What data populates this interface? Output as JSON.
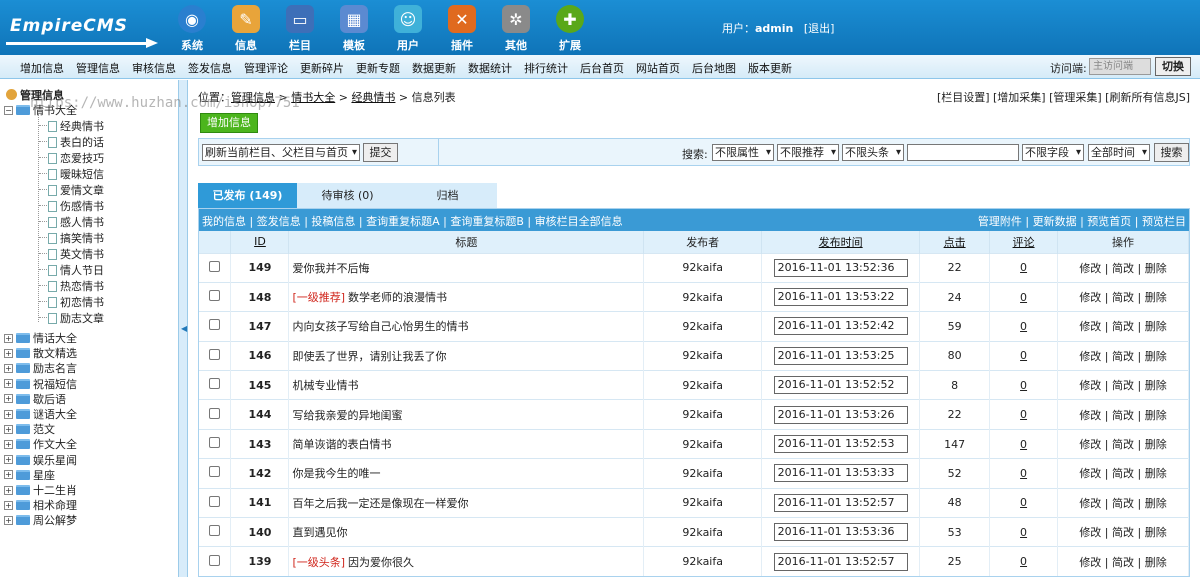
{
  "brand": {
    "logo_text": "EmpireCMS"
  },
  "topnav": [
    {
      "label": "系统",
      "icon": "globe-icon",
      "color": "#2a7fcf"
    },
    {
      "label": "信息",
      "icon": "notepad-icon",
      "color": "#e8a43a"
    },
    {
      "label": "栏目",
      "icon": "folder-icon",
      "color": "#3d6fb8"
    },
    {
      "label": "模板",
      "icon": "window-icon",
      "color": "#5b8ad1"
    },
    {
      "label": "用户",
      "icon": "user-icon",
      "color": "#3fb1d9"
    },
    {
      "label": "插件",
      "icon": "tools-icon",
      "color": "#e06a1f"
    },
    {
      "label": "其他",
      "icon": "gear-icon",
      "color": "#8a8a8a"
    },
    {
      "label": "扩展",
      "icon": "plus-icon",
      "color": "#5aa819"
    }
  ],
  "user": {
    "prefix": "用户：",
    "name": "admin",
    "logout": "[退出]"
  },
  "subnav": [
    "增加信息",
    "管理信息",
    "审核信息",
    "签发信息",
    "管理评论",
    "更新碎片",
    "更新专题",
    "数据更新",
    "数据统计",
    "排行统计",
    "后台首页",
    "网站首页",
    "后台地图",
    "版本更新"
  ],
  "visit": {
    "label": "访问端:",
    "selected": "主访问端",
    "button": "切换"
  },
  "watermark": "https://www.huzhan.com/ishop7751",
  "tree": {
    "root": "管理信息",
    "open_node": "情书大全",
    "children": [
      "经典情书",
      "表白的话",
      "恋爱技巧",
      "暧昧短信",
      "爱情文章",
      "伤感情书",
      "感人情书",
      "搞笑情书",
      "英文情书",
      "情人节日",
      "热恋情书",
      "初恋情书",
      "励志文章"
    ],
    "nodes": [
      "情话大全",
      "散文精选",
      "励志名言",
      "祝福短信",
      "歇后语",
      "谜语大全",
      "范文",
      "作文大全",
      "娱乐星闻",
      "星座",
      "十二生肖",
      "相术命理",
      "周公解梦"
    ]
  },
  "location": {
    "prefix": "位置：",
    "crumbs": [
      "管理信息",
      "情书大全",
      "经典情书"
    ],
    "sep": " > ",
    "last": "信息列表"
  },
  "location_links": "[栏目设置] [增加采集] [管理采集] [刷新所有信息JS]",
  "add_button": "增加信息",
  "refresh": {
    "selected": "刷新当前栏目、父栏目与首页",
    "submit": "提交"
  },
  "search": {
    "label": "搜索:",
    "attr": "不限属性",
    "recommend": "不限推荐",
    "headline": "不限头条",
    "keyword": "",
    "field": "不限字段",
    "time": "全部时间",
    "button": "搜索"
  },
  "tabs": [
    {
      "label": "已发布 (149)",
      "active": true
    },
    {
      "label": "待审核 (0)",
      "active": false
    },
    {
      "label": "归档",
      "active": false
    }
  ],
  "toolbar": {
    "left": "我的信息 | 签发信息 | 投稿信息 | 查询重复标题A | 查询重复标题B | 审核栏目全部信息",
    "right": "管理附件 | 更新数据 | 预览首页 | 预览栏目"
  },
  "columns": {
    "id": "ID",
    "title": "标题",
    "publisher": "发布者",
    "time": "发布时间",
    "clicks": "点击",
    "comments": "评论",
    "ops": "操作"
  },
  "ops": {
    "edit": "修改",
    "quick_edit": "简改",
    "delete": "删除",
    "sep": " | "
  },
  "rows": [
    {
      "id": "149",
      "tag": "",
      "title": "爱你我并不后悔",
      "publisher": "92kaifa",
      "time": "2016-11-01 13:52:36",
      "clicks": "22",
      "comments": "0"
    },
    {
      "id": "148",
      "tag": "[一级推荐]",
      "title": "数学老师的浪漫情书",
      "publisher": "92kaifa",
      "time": "2016-11-01 13:53:22",
      "clicks": "24",
      "comments": "0"
    },
    {
      "id": "147",
      "tag": "",
      "title": "内向女孩子写给自己心怡男生的情书",
      "publisher": "92kaifa",
      "time": "2016-11-01 13:52:42",
      "clicks": "59",
      "comments": "0"
    },
    {
      "id": "146",
      "tag": "",
      "title": "即使丢了世界，请别让我丢了你",
      "publisher": "92kaifa",
      "time": "2016-11-01 13:53:25",
      "clicks": "80",
      "comments": "0"
    },
    {
      "id": "145",
      "tag": "",
      "title": "机械专业情书",
      "publisher": "92kaifa",
      "time": "2016-11-01 13:52:52",
      "clicks": "8",
      "comments": "0"
    },
    {
      "id": "144",
      "tag": "",
      "title": "写给我亲爱的异地闺蜜",
      "publisher": "92kaifa",
      "time": "2016-11-01 13:53:26",
      "clicks": "22",
      "comments": "0"
    },
    {
      "id": "143",
      "tag": "",
      "title": "简单诙谐的表白情书",
      "publisher": "92kaifa",
      "time": "2016-11-01 13:52:53",
      "clicks": "147",
      "comments": "0"
    },
    {
      "id": "142",
      "tag": "",
      "title": "你是我今生的唯一",
      "publisher": "92kaifa",
      "time": "2016-11-01 13:53:33",
      "clicks": "52",
      "comments": "0"
    },
    {
      "id": "141",
      "tag": "",
      "title": "百年之后我一定还是像现在一样爱你",
      "publisher": "92kaifa",
      "time": "2016-11-01 13:52:57",
      "clicks": "48",
      "comments": "0"
    },
    {
      "id": "140",
      "tag": "",
      "title": "直到遇见你",
      "publisher": "92kaifa",
      "time": "2016-11-01 13:53:36",
      "clicks": "53",
      "comments": "0"
    },
    {
      "id": "139",
      "tag": "[一级头条]",
      "title": "因为爱你很久",
      "publisher": "92kaifa",
      "time": "2016-11-01 13:52:57",
      "clicks": "25",
      "comments": "0"
    }
  ]
}
